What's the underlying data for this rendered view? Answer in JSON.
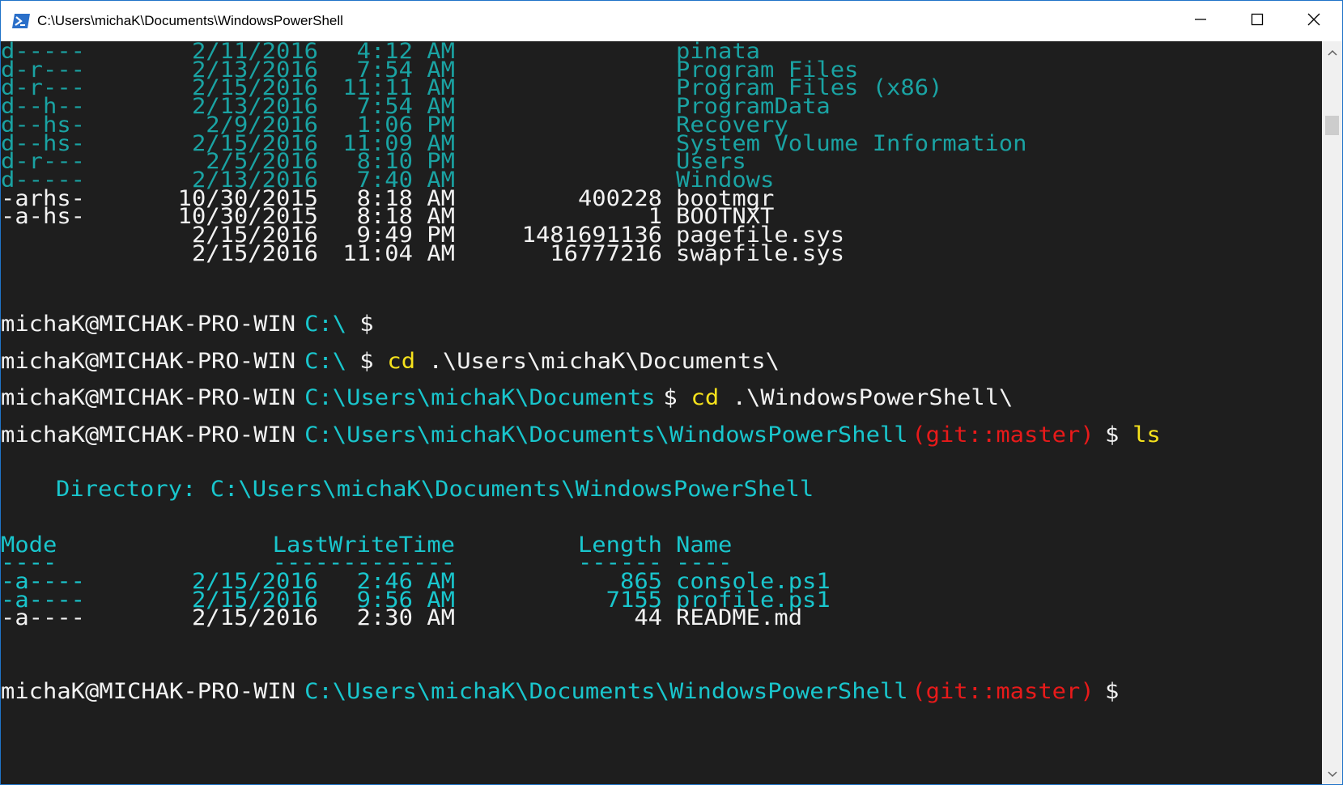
{
  "window": {
    "title": "C:\\Users\\michaK\\Documents\\WindowsPowerShell",
    "icon": "powershell-icon",
    "border_color": "#1f73c8"
  },
  "controls": {
    "minimize": "minimize-icon",
    "maximize": "maximize-icon",
    "close": "close-icon"
  },
  "colors": {
    "background": "#1e1e1e",
    "foreground": "#f2f2f2",
    "cyan": "#19c6cd",
    "yellow": "#f6e21c",
    "red": "#e81a1a"
  },
  "listing1": [
    {
      "mode": "d-----",
      "date": "2/11/2016",
      "time": "4:12 AM",
      "length": "",
      "name": "pinata"
    },
    {
      "mode": "d-r---",
      "date": "2/13/2016",
      "time": "7:54 AM",
      "length": "",
      "name": "Program Files"
    },
    {
      "mode": "d-r---",
      "date": "2/15/2016",
      "time": "11:11 AM",
      "length": "",
      "name": "Program Files (x86)"
    },
    {
      "mode": "d--h--",
      "date": "2/13/2016",
      "time": "7:54 AM",
      "length": "",
      "name": "ProgramData"
    },
    {
      "mode": "d--hs-",
      "date": "2/9/2016",
      "time": "1:06 PM",
      "length": "",
      "name": "Recovery"
    },
    {
      "mode": "d--hs-",
      "date": "2/15/2016",
      "time": "11:09 AM",
      "length": "",
      "name": "System Volume Information"
    },
    {
      "mode": "d-r---",
      "date": "2/5/2016",
      "time": "8:10 PM",
      "length": "",
      "name": "Users"
    },
    {
      "mode": "d-----",
      "date": "2/13/2016",
      "time": "7:40 AM",
      "length": "",
      "name": "Windows"
    },
    {
      "mode": "-arhs-",
      "date": "10/30/2015",
      "time": "8:18 AM",
      "length": "400228",
      "name": "bootmgr"
    },
    {
      "mode": "-a-hs-",
      "date": "10/30/2015",
      "time": "8:18 AM",
      "length": "1",
      "name": "BOOTNXT"
    },
    {
      "mode": "",
      "date": "2/15/2016",
      "time": "9:49 PM",
      "length": "1481691136",
      "name": "pagefile.sys"
    },
    {
      "mode": "",
      "date": "2/15/2016",
      "time": "11:04 AM",
      "length": "16777216",
      "name": "swapfile.sys"
    }
  ],
  "prompts": [
    {
      "user": "michaK@MICHAK-PRO-WIN",
      "path": "C:\\",
      "git": "",
      "symbol": "$",
      "command": "",
      "args": ""
    },
    {
      "user": "michaK@MICHAK-PRO-WIN",
      "path": "C:\\",
      "git": "",
      "symbol": "$",
      "command": "cd",
      "args": ".\\Users\\michaK\\Documents\\"
    },
    {
      "user": "michaK@MICHAK-PRO-WIN",
      "path": "C:\\Users\\michaK\\Documents",
      "git": "",
      "symbol": "$",
      "command": "cd",
      "args": ".\\WindowsPowerShell\\"
    },
    {
      "user": "michaK@MICHAK-PRO-WIN",
      "path": "C:\\Users\\michaK\\Documents\\WindowsPowerShell",
      "git": "(git::master)",
      "symbol": "$",
      "command": "ls",
      "args": ""
    },
    {
      "user": "michaK@MICHAK-PRO-WIN",
      "path": "C:\\Users\\michaK\\Documents\\WindowsPowerShell",
      "git": "(git::master)",
      "symbol": "$",
      "command": "",
      "args": ""
    }
  ],
  "directory_header": "Directory: C:\\Users\\michaK\\Documents\\WindowsPowerShell",
  "columns": {
    "mode": "Mode",
    "lastwritetime": "LastWriteTime",
    "length": "Length",
    "name": "Name",
    "mode_rule": "----",
    "lastwritetime_rule": "-------------",
    "length_rule": "------",
    "name_rule": "----"
  },
  "listing2": [
    {
      "mode": "-a----",
      "date": "2/15/2016",
      "time": "2:46 AM",
      "length": "865",
      "name": "console.ps1"
    },
    {
      "mode": "-a----",
      "date": "2/15/2016",
      "time": "9:56 AM",
      "length": "7155",
      "name": "profile.ps1"
    },
    {
      "mode": "-a----",
      "date": "2/15/2016",
      "time": "2:30 AM",
      "length": "44",
      "name": "README.md"
    }
  ],
  "scrollbar": {
    "up": "scroll-up-arrow-icon",
    "down": "scroll-down-arrow-icon"
  }
}
